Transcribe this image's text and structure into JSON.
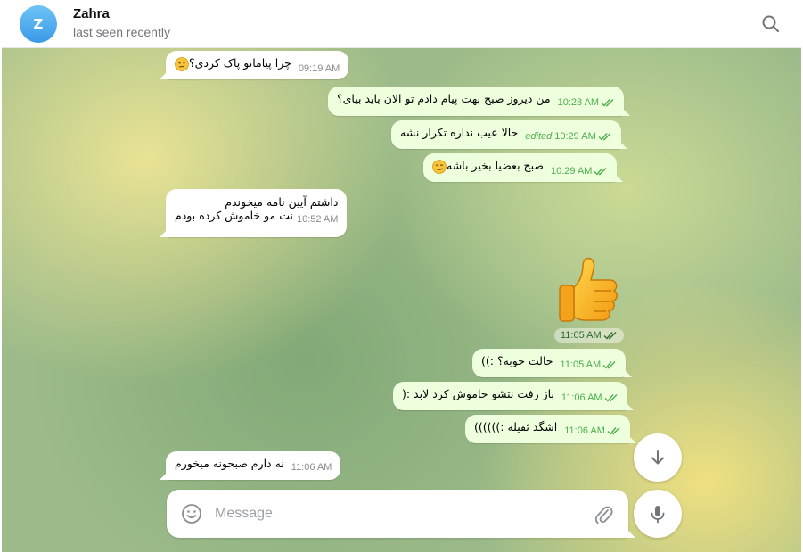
{
  "header": {
    "avatar_letter": "Z",
    "name": "Zahra",
    "status": "last seen recently"
  },
  "messages": [
    {
      "dir": "in",
      "text": "چرا پیاماتو پاک کردی؟",
      "emoji": "confused-face",
      "time": "09:19 AM"
    },
    {
      "dir": "out",
      "text": "من دیروز صبح بهت پیام دادم تو الان باید بیای؟",
      "time": "10:28 AM",
      "read": true
    },
    {
      "dir": "out",
      "text": "حالا عیب نداره تکرار نشه",
      "edited": "edited",
      "time": "10:29 AM",
      "read": true
    },
    {
      "dir": "out",
      "text": "صبح بعضیا بخیر باشه",
      "emoji": "smirk-face",
      "time": "10:29 AM",
      "read": true
    },
    {
      "dir": "in",
      "line1": "داشتم آیین نامه میخوندم",
      "line2": "نت مو خاموش کرده بودم",
      "time": "10:52 AM"
    },
    {
      "dir": "out",
      "sticker": "thumbs-up",
      "time": "11:05 AM",
      "read": true
    },
    {
      "dir": "out",
      "text": "حالت خوبه؟ :))",
      "time": "11:05 AM",
      "read": true
    },
    {
      "dir": "out",
      "text": "باز رفت نتشو خاموش کرد لابد :(",
      "time": "11:06 AM",
      "read": true
    },
    {
      "dir": "out",
      "text": "اشگد ثقیله :))))))",
      "time": "11:06 AM",
      "read": true
    },
    {
      "dir": "in",
      "text": "نه دارم صبحونه میخورم",
      "time": "11:06 AM"
    }
  ],
  "composer": {
    "placeholder": "Message"
  },
  "colors": {
    "outgoing_bubble": "#eeffde",
    "incoming_bubble": "#ffffff",
    "read_check": "#4fae4e",
    "avatar": "#3a9ae8"
  }
}
